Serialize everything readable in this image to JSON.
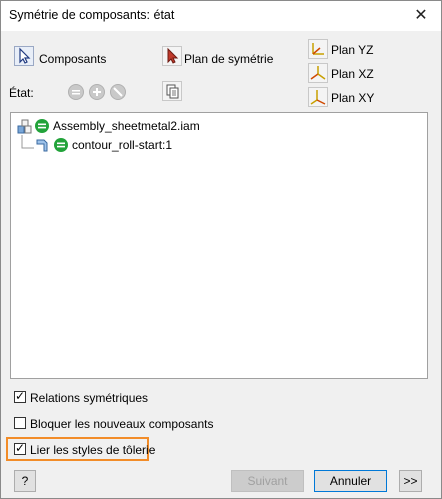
{
  "window": {
    "title": "Symétrie de composants: état",
    "close_glyph": "✕"
  },
  "toolbar": {
    "components_label": "Composants",
    "mirror_plane_label": "Plan de symétrie",
    "planes": [
      "Plan YZ",
      "Plan XZ",
      "Plan XY"
    ],
    "state_label": "État:"
  },
  "tree": {
    "root": "Assembly_sheetmetal2.iam",
    "child": "contour_roll-start:1"
  },
  "options": {
    "symmetric_relations": {
      "label": "Relations symétriques",
      "checked": true
    },
    "block_new_components": {
      "label": "Bloquer les nouveaux composants",
      "checked": false
    },
    "link_sheetmetal_styles": {
      "label": "Lier les styles de tôlerie",
      "checked": true
    }
  },
  "footer": {
    "help_glyph": "?",
    "next_label": "Suivant",
    "cancel_label": "Annuler",
    "more_label": ">>"
  },
  "colors": {
    "highlight": "#f28c28",
    "green_state": "#22a33a"
  }
}
